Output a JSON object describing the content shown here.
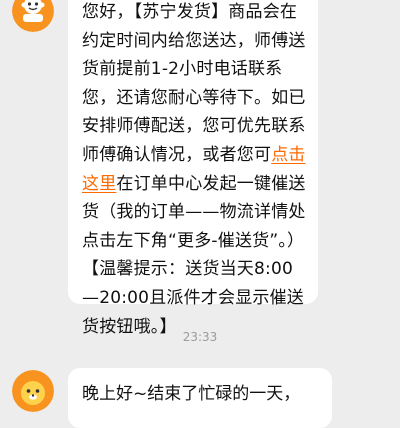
{
  "messages": [
    {
      "segments": [
        {
          "text": "您好，【苏宁发货】商品会在约定时间内给您送达，师傅送货前提前1-2小时电话联系您，还请您耐心等待下。如已安排师傅配送，您可优先联系师傅确认情况，或者您可",
          "type": "text"
        },
        {
          "text": "点击这里",
          "type": "link"
        },
        {
          "text": "在订单中心发起一键催送货（我的订单——物流详情处点击左下角“更多-催送货”。）【温馨提示：送货当天8:00—20:00且派件才会显示催送货按钮哦。】",
          "type": "text"
        }
      ]
    },
    {
      "text": "晚上好~结束了忙碌的一天，"
    }
  ],
  "timestamp": "23:33",
  "colors": {
    "background": "#ededed",
    "bubble": "#ffffff",
    "link": "#ff6a00",
    "timestamp": "#9b9b9b",
    "avatar_orange": "#f7931e"
  },
  "icons": {
    "agent_avatar_top": "bot-avatar-icon",
    "agent_avatar_bottom": "lion-avatar-icon"
  }
}
